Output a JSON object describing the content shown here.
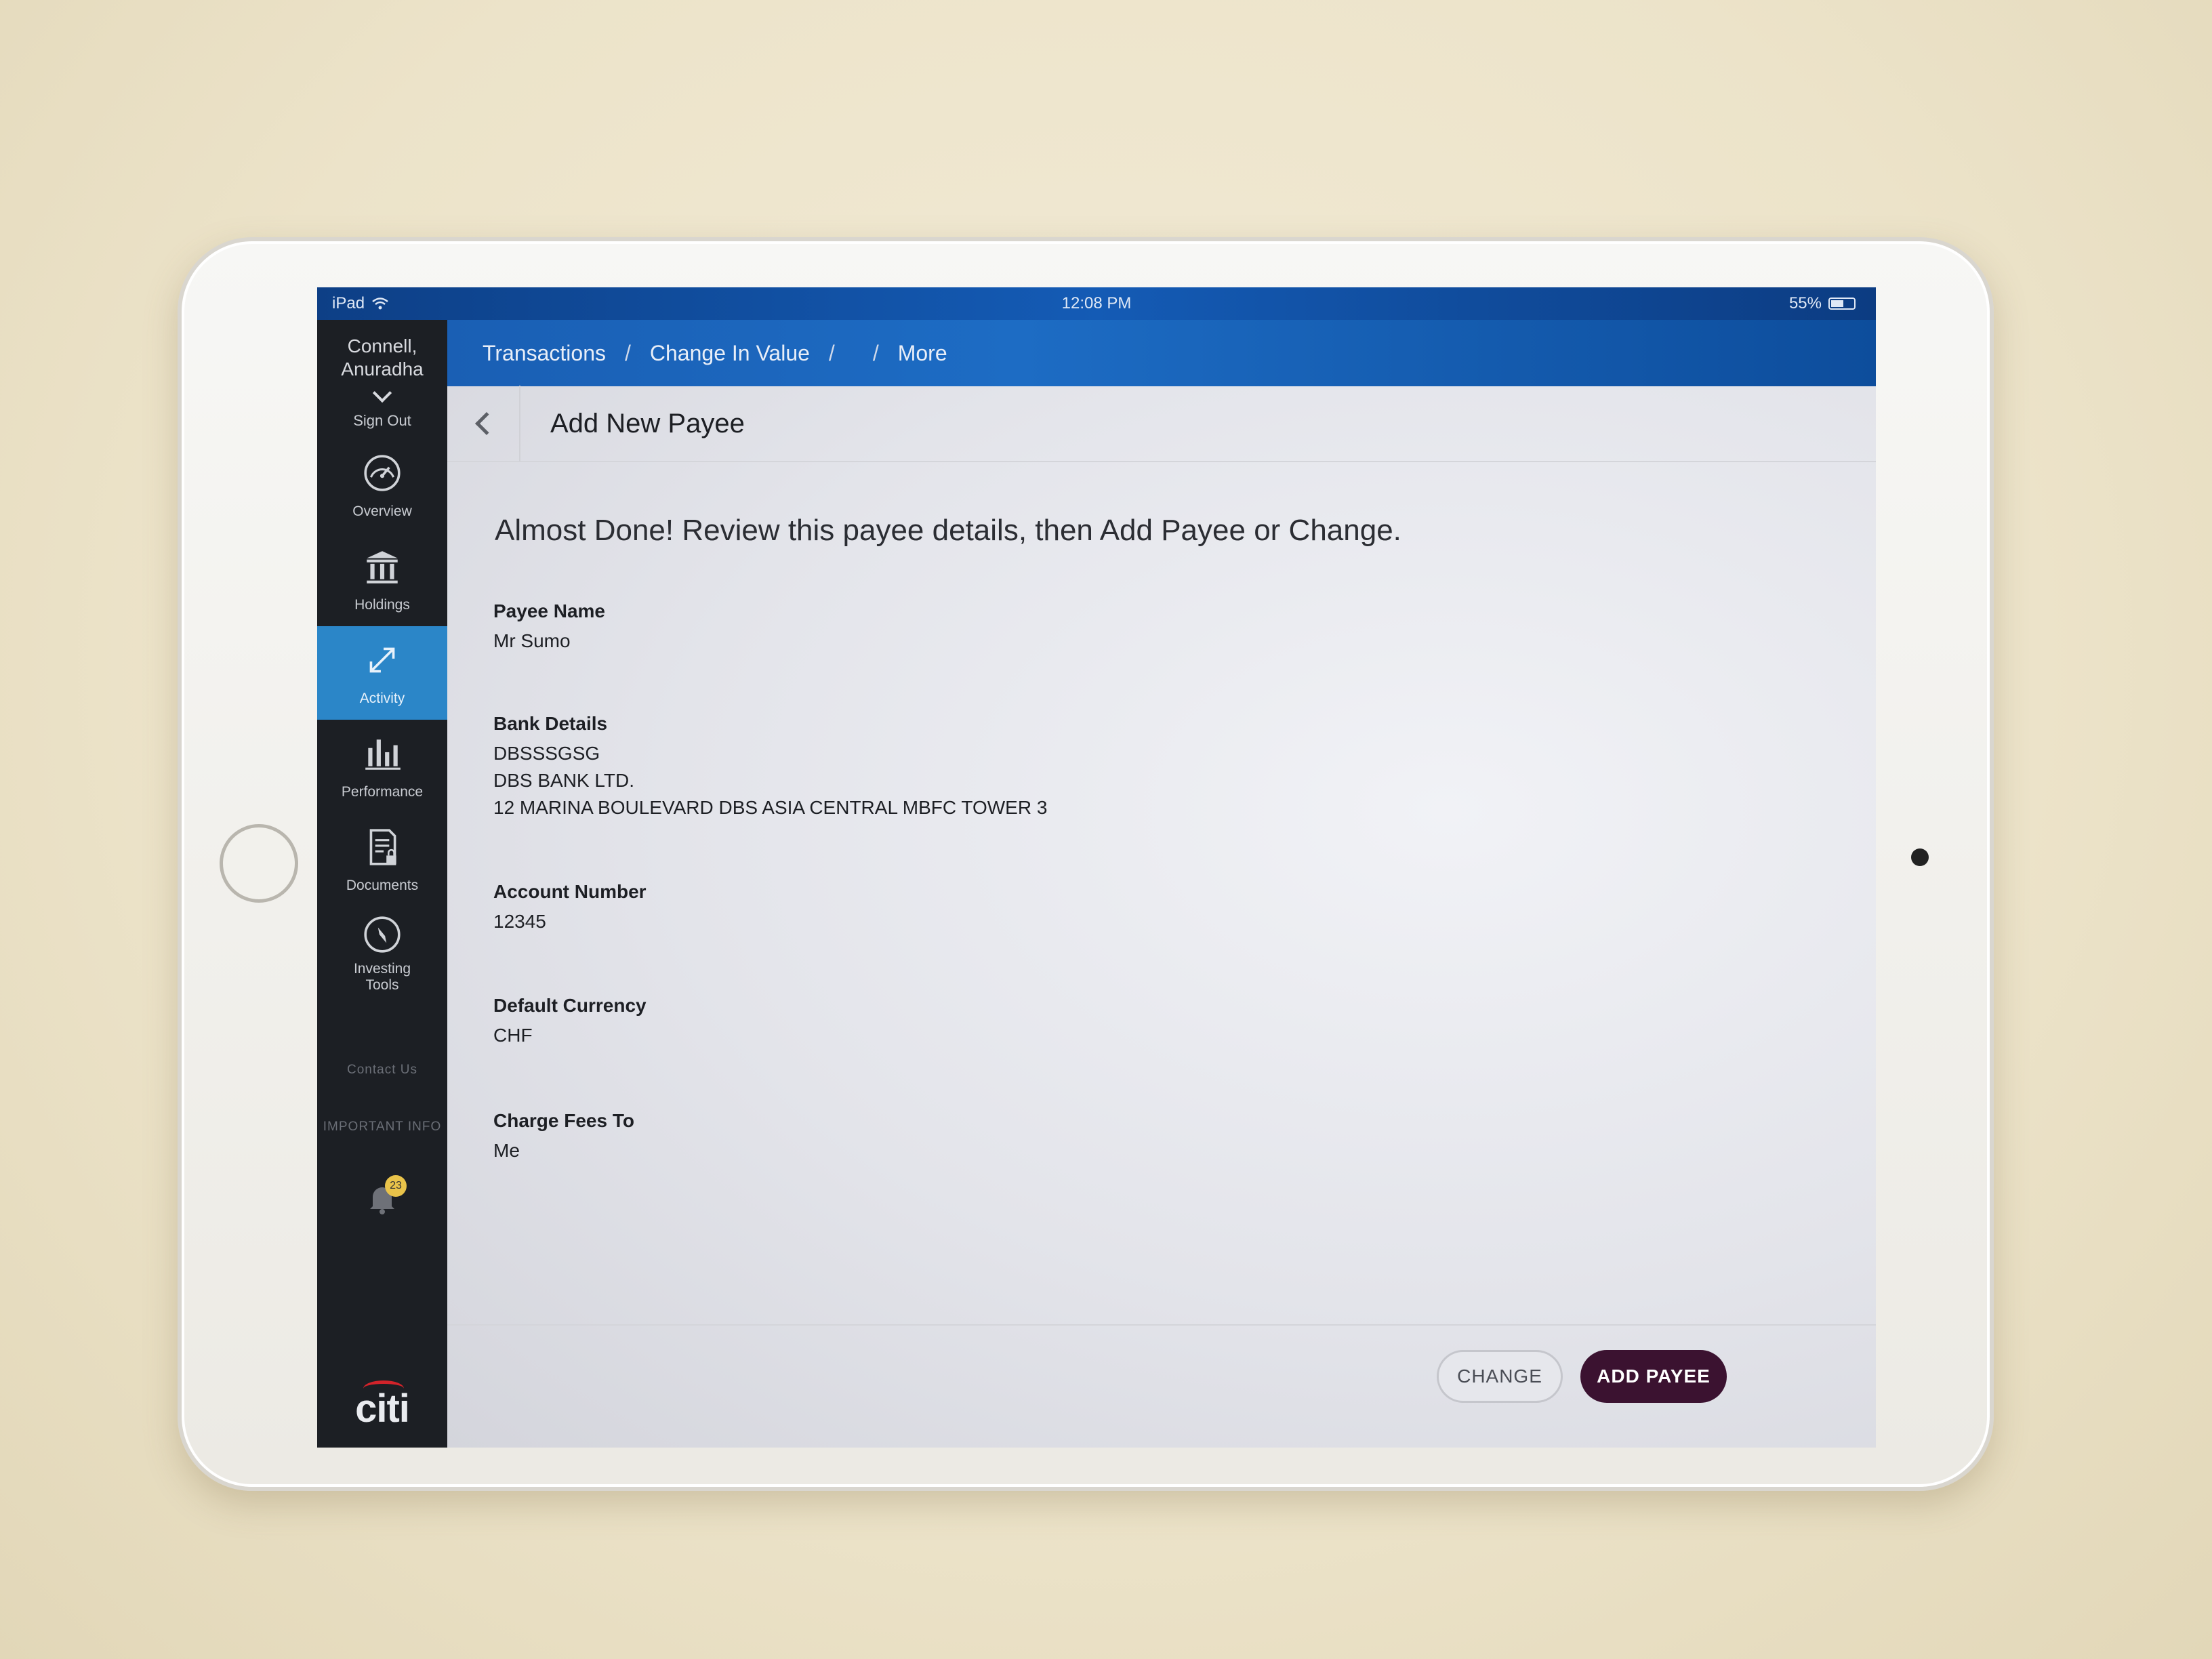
{
  "status_bar": {
    "device": "iPad",
    "time": "12:08 PM",
    "battery": "55%",
    "battery_level": 0.55
  },
  "sidebar": {
    "user_name_line1": "Connell,",
    "user_name_line2": "Anuradha",
    "sign_out": "Sign Out",
    "items": [
      {
        "label": "Overview",
        "icon": "gauge-icon",
        "active": false
      },
      {
        "label": "Holdings",
        "icon": "bank-icon",
        "active": false
      },
      {
        "label": "Activity",
        "icon": "expand-arrows-icon",
        "active": true
      },
      {
        "label": "Performance",
        "icon": "bar-chart-icon",
        "active": false
      },
      {
        "label": "Documents",
        "icon": "document-lock-icon",
        "active": false
      },
      {
        "label_line1": "Investing",
        "label_line2": "Tools",
        "icon": "compass-icon",
        "active": false
      }
    ],
    "contact_us": "Contact Us",
    "important_info": "IMPORTANT INFO",
    "notification_count": "23",
    "logo": "citi"
  },
  "breadcrumb": {
    "items": [
      "Transactions",
      "Change In Value",
      "",
      "More"
    ],
    "separator": "/"
  },
  "page": {
    "title": "Add New Payee",
    "intro": "Almost Done! Review this payee details, then Add Payee or Change.",
    "fields": {
      "payee_name": {
        "label": "Payee Name",
        "value": "Mr Sumo"
      },
      "bank_details": {
        "label": "Bank Details",
        "lines": [
          "DBSSSGSG",
          "DBS BANK LTD.",
          "12 MARINA BOULEVARD DBS ASIA CENTRAL MBFC TOWER 3"
        ]
      },
      "account_number": {
        "label": "Account Number",
        "value": "12345"
      },
      "default_currency": {
        "label": "Default Currency",
        "value": "CHF"
      },
      "charge_fees_to": {
        "label": "Charge Fees To",
        "value": "Me"
      }
    },
    "buttons": {
      "change": "CHANGE",
      "add_payee": "ADD PAYEE"
    }
  },
  "colors": {
    "header_blue": "#1d6cc4",
    "sidebar_bg": "#1c1f24",
    "active_nav": "#2b86c8",
    "primary_button": "#3b1230",
    "citi_red": "#d1232a"
  }
}
